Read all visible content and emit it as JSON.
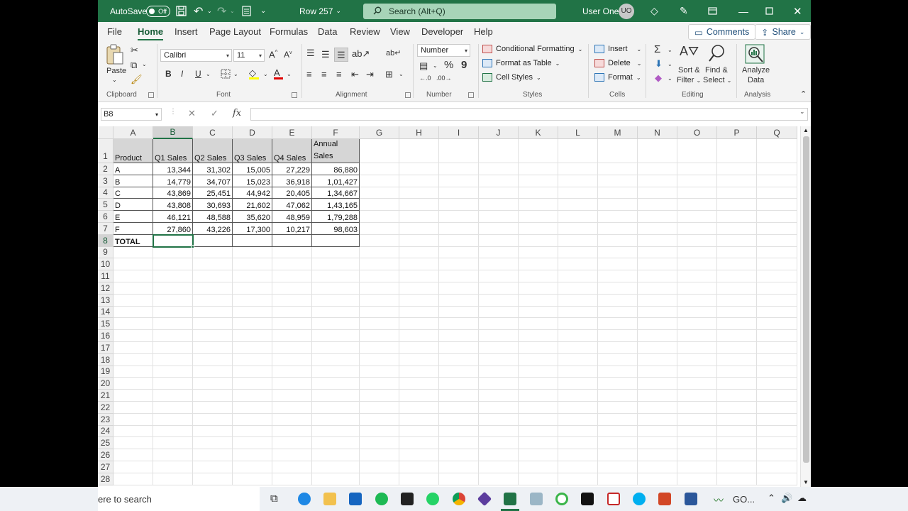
{
  "titlebar": {
    "autosave_label": "AutoSave",
    "autosave_state": "Off",
    "doc_title": "Row 257",
    "search_placeholder": "Search (Alt+Q)",
    "user_name": "User One",
    "user_initials": "UO"
  },
  "menu": {
    "tabs": [
      "File",
      "Home",
      "Insert",
      "Page Layout",
      "Formulas",
      "Data",
      "Review",
      "View",
      "Developer",
      "Help"
    ],
    "active": "Home",
    "comments_label": "Comments",
    "share_label": "Share"
  },
  "ribbon": {
    "clipboard": {
      "paste_label": "Paste",
      "group_label": "Clipboard"
    },
    "font": {
      "font_name": "Calibri",
      "font_size": "11",
      "group_label": "Font",
      "bold": "B",
      "italic": "I",
      "underline": "U"
    },
    "alignment": {
      "group_label": "Alignment"
    },
    "number": {
      "format": "Number",
      "percent": "%",
      "comma": "9",
      "group_label": "Number"
    },
    "styles": {
      "conditional_formatting": "Conditional Formatting",
      "format_as_table": "Format as Table",
      "cell_styles": "Cell Styles",
      "group_label": "Styles"
    },
    "cells": {
      "insert": "Insert",
      "delete": "Delete",
      "format": "Format",
      "group_label": "Cells"
    },
    "editing": {
      "sum_icon": "Σ",
      "sort_filter_1": "Sort &",
      "sort_filter_2": "Filter",
      "find_select_1": "Find &",
      "find_select_2": "Select",
      "group_label": "Editing"
    },
    "analysis": {
      "analyze_1": "Analyze",
      "analyze_2": "Data",
      "group_label": "Analysis"
    }
  },
  "formula_bar": {
    "name_box": "B8",
    "fx": "fx",
    "formula": ""
  },
  "sheet": {
    "columns": [
      "A",
      "B",
      "C",
      "D",
      "E",
      "F",
      "G",
      "H",
      "I",
      "J",
      "K",
      "L",
      "M",
      "N",
      "O",
      "P",
      "Q"
    ],
    "selected_cell": "B8",
    "header_row": [
      "Product",
      "Q1 Sales",
      "Q2 Sales",
      "Q3 Sales",
      "Q4 Sales",
      "Annual",
      "Sales"
    ],
    "rows": [
      [
        "A",
        "13,344",
        "31,302",
        "15,005",
        "27,229",
        "86,880"
      ],
      [
        "B",
        "14,779",
        "34,707",
        "15,023",
        "36,918",
        "1,01,427"
      ],
      [
        "C",
        "43,869",
        "25,451",
        "44,942",
        "20,405",
        "1,34,667"
      ],
      [
        "D",
        "43,808",
        "30,693",
        "21,602",
        "47,062",
        "1,43,165"
      ],
      [
        "E",
        "46,121",
        "48,588",
        "35,620",
        "48,959",
        "1,79,288"
      ],
      [
        "F",
        "27,860",
        "43,226",
        "17,300",
        "10,217",
        "98,603"
      ]
    ],
    "total_label": "TOTAL",
    "row_count": 28
  },
  "taskbar": {
    "search_text": "ere to search",
    "app_label": "GO..."
  },
  "colors": {
    "excel_green": "#217346",
    "titlebar": "#217346",
    "ribbon_bg": "#f3f3f3"
  }
}
